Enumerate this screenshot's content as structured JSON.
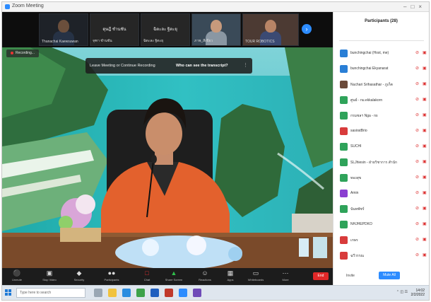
{
  "window": {
    "title": "Zoom Meeting"
  },
  "thumbnails": [
    {
      "type": "video",
      "name": "Thanachai Kaewsuwan"
    },
    {
      "type": "name",
      "label": "ดุษฎี ชำนชัน",
      "name": "จุฑา ชำนชัน"
    },
    {
      "type": "name",
      "label": "ฉิตะละ ฐิตะยุ",
      "name": "ฉิตะละ ฐิตะยุ"
    },
    {
      "type": "video",
      "name": "ภาพ_สีเขียว"
    },
    {
      "type": "video",
      "name": "TOUR ROBOTICS"
    }
  ],
  "recording_tag": "Recording...",
  "banner": {
    "text": "Leave Meeting or Continue Recording",
    "link": "Who can see the transcript?"
  },
  "toolbar": [
    {
      "label": "Unmute",
      "icon": "mic-icon"
    },
    {
      "label": "Stop Video",
      "icon": "video-icon"
    },
    {
      "label": "Security",
      "icon": "shield-icon"
    },
    {
      "label": "Participants",
      "icon": "participants-icon"
    },
    {
      "label": "Chat",
      "icon": "chat-icon"
    },
    {
      "label": "Share Screen",
      "icon": "share-icon",
      "accent": "#2fbf4b"
    },
    {
      "label": "Reactions",
      "icon": "reactions-icon"
    },
    {
      "label": "Apps",
      "icon": "apps-icon"
    },
    {
      "label": "Whiteboards",
      "icon": "whiteboard-icon"
    },
    {
      "label": "More",
      "icon": "more-icon"
    }
  ],
  "end_label": "End",
  "panel": {
    "title": "Participants (28)",
    "search_placeholder": "",
    "participants": [
      {
        "name": "bunchingchai (Host, me)",
        "color": "#2a7fd6"
      },
      {
        "name": "bunchingchai Ekyanarat",
        "color": "#2a7fd6"
      },
      {
        "name": "Nuchari Srihasathar - ภูเก็ต",
        "color": "#6b4a3a"
      },
      {
        "name": "ศูนย์ - nu.ekkalakorn",
        "color": "#2fa35a"
      },
      {
        "name": "กรมชลฯ Nga - ns",
        "color": "#2fa35a"
      },
      {
        "name": "sasiratBrio",
        "color": "#d83b3b"
      },
      {
        "name": "SUCHI",
        "color": "#2fa35a"
      },
      {
        "name": "SLJhiesin - ฝ่ายวิชาการ สำนัก",
        "color": "#2fa35a"
      },
      {
        "name": "ทองสุข",
        "color": "#2fa35a"
      },
      {
        "name": "Amin",
        "color": "#8b3fd1"
      },
      {
        "name": "นันทพัชร์",
        "color": "#2fa35a"
      },
      {
        "name": "NHJHEPDKO",
        "color": "#2fa35a"
      },
      {
        "name": "เกษร",
        "color": "#d83b3b"
      },
      {
        "name": "ฉวีวรรณ",
        "color": "#d83b3b"
      }
    ],
    "invite_label": "Invite",
    "mute_all_label": "Mute All"
  },
  "taskbar": {
    "search_placeholder": "Type here to search",
    "clock_time": "14:02",
    "clock_date": "2/2/2022"
  }
}
